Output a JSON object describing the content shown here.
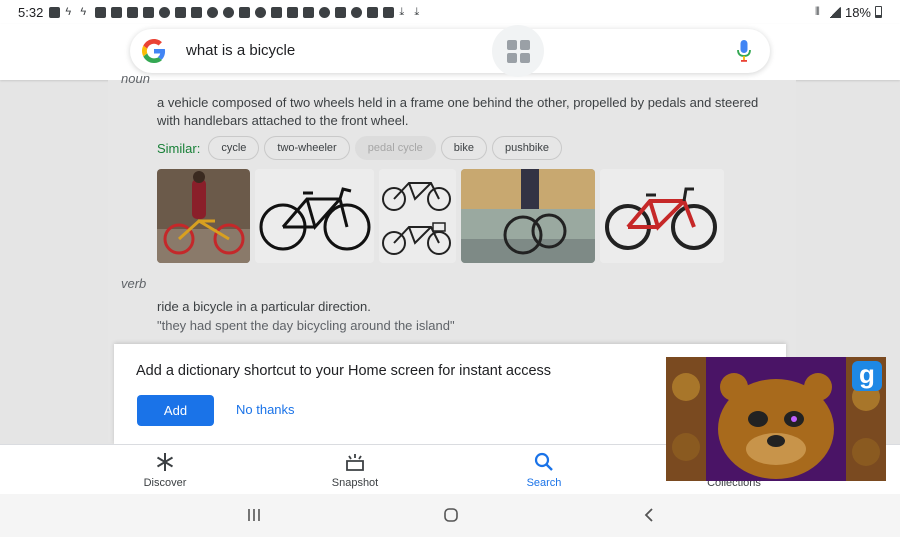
{
  "status_bar": {
    "time": "5:32",
    "battery": "18%"
  },
  "search": {
    "query": "what is a bicycle"
  },
  "dictionary": {
    "noun_label": "noun",
    "noun_definition": "a vehicle composed of two wheels held in a frame one behind the other, propelled by pedals and steered with handlebars attached to the front wheel.",
    "similar_label": "Similar:",
    "similar_chips": [
      "cycle",
      "two-wheeler",
      "pedal cycle",
      "bike",
      "pushbike"
    ],
    "verb_label": "verb",
    "verb_definition": "ride a bicycle in a particular direction.",
    "verb_example": "\"they had spent the day bicycling around the island\""
  },
  "promo": {
    "message": "Add a dictionary shortcut to your Home screen for instant access",
    "add_label": "Add",
    "no_thanks_label": "No thanks"
  },
  "bottom_nav": {
    "items": [
      {
        "label": "Discover",
        "icon": "asterisk-icon"
      },
      {
        "label": "Snapshot",
        "icon": "snapshot-icon"
      },
      {
        "label": "Search",
        "icon": "search-icon"
      },
      {
        "label": "Collections",
        "icon": "collections-icon"
      }
    ],
    "active": "Search"
  },
  "pip_video": {
    "badge": "g"
  },
  "colors": {
    "accent": "#1a73e8",
    "similar_green": "#188038"
  }
}
